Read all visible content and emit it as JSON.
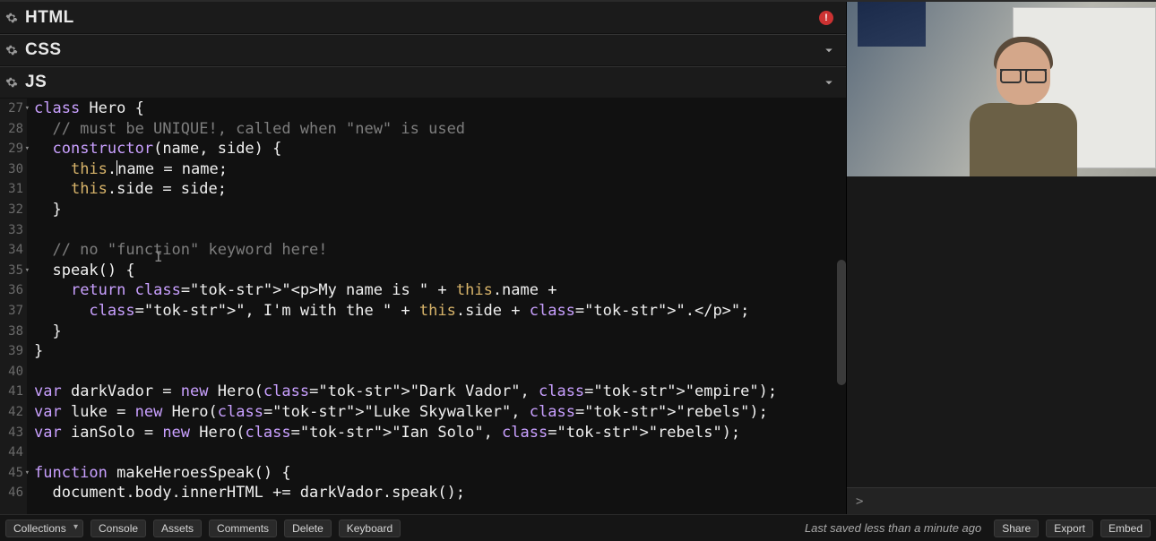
{
  "panels": {
    "html": {
      "title": "HTML",
      "has_error": true,
      "error_badge": "!"
    },
    "css": {
      "title": "CSS"
    },
    "js": {
      "title": "JS"
    }
  },
  "gutter_start": 27,
  "fold_lines": [
    27,
    29,
    35,
    45
  ],
  "code_lines": [
    "class Hero {",
    "  // must be UNIQUE!, called when \"new\" is used",
    "  constructor(name, side) {",
    "    this.name = name;",
    "    this.side = side;",
    "  }",
    "",
    "  // no \"function\" keyword here!",
    "  speak() {",
    "    return \"<p>My name is \" + this.name +",
    "      \", I'm with the \" + this.side + \".</p>\";",
    "  }",
    "}",
    "",
    "var darkVador = new Hero(\"Dark Vador\", \"empire\");",
    "var luke = new Hero(\"Luke Skywalker\", \"rebels\");",
    "var ianSolo = new Hero(\"Ian Solo\", \"rebels\");",
    "",
    "function makeHeroesSpeak() {",
    "  document.body.innerHTML += darkVador.speak();"
  ],
  "repl_prompt": ">",
  "footer": {
    "collections": "Collections",
    "console": "Console",
    "assets": "Assets",
    "comments": "Comments",
    "delete": "Delete",
    "keyboard": "Keyboard",
    "save_status": "Last saved less than a minute ago",
    "share": "Share",
    "export": "Export",
    "embed": "Embed"
  }
}
